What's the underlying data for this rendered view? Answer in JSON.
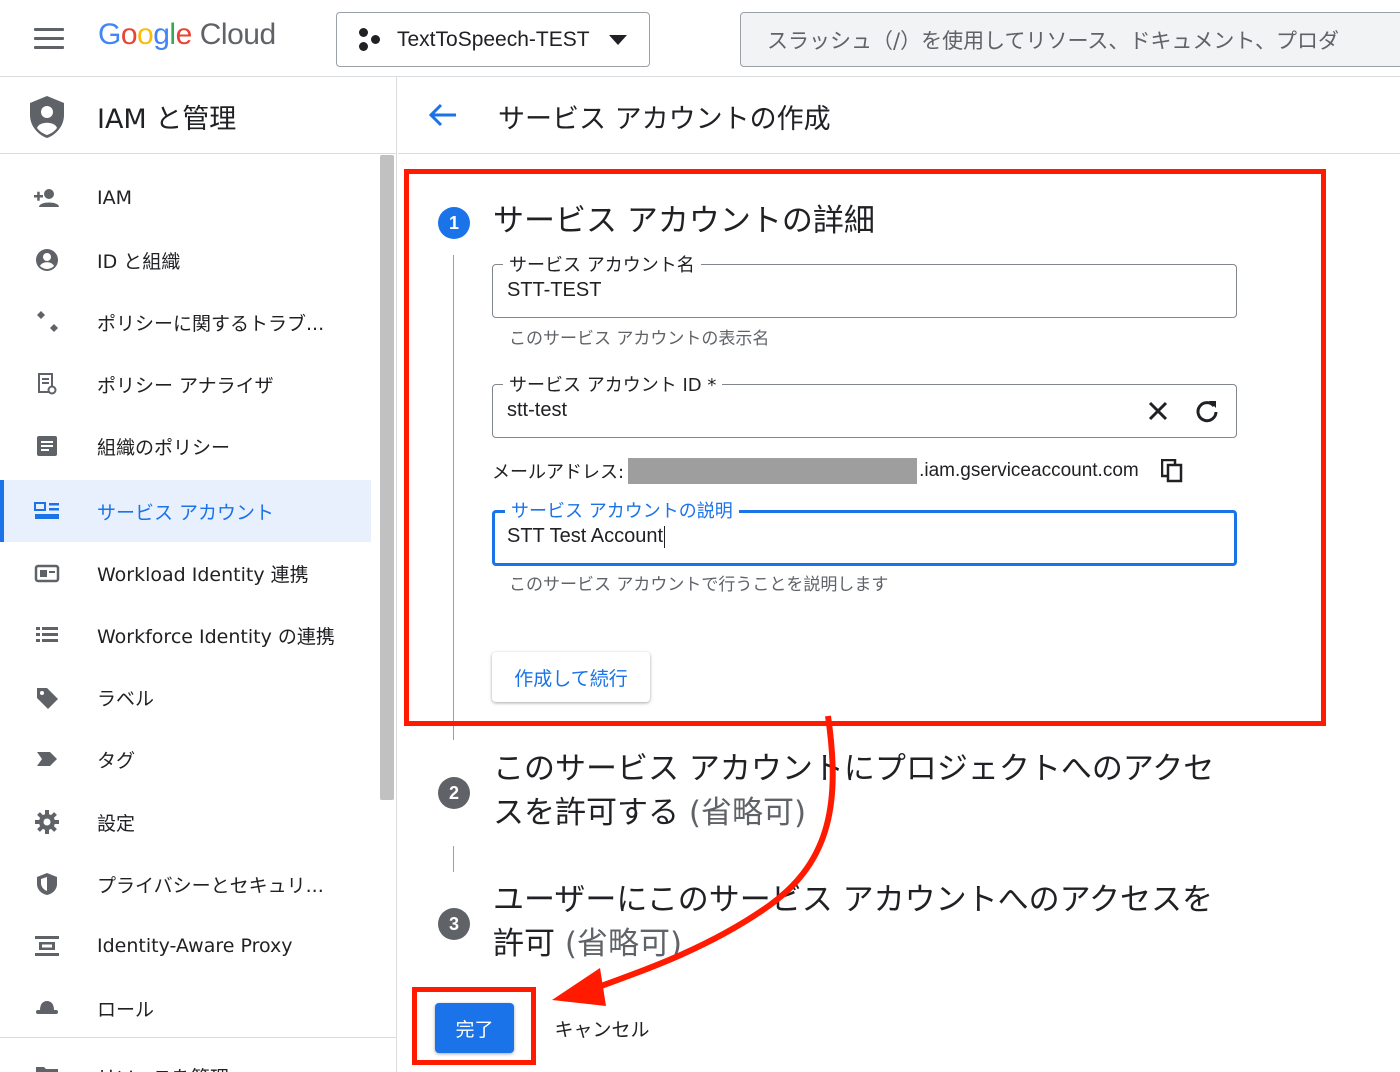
{
  "header": {
    "logo_text": "Google Cloud",
    "logo_letters": [
      "G",
      "o",
      "o",
      "g",
      "l",
      "e"
    ],
    "logo_cloud": "Cloud",
    "project_name": "TextToSpeech-TEST",
    "search_placeholder": "スラッシュ（/）を使用してリソース、ドキュメント、プロダ"
  },
  "sidebar": {
    "title": "IAM と管理",
    "items": [
      {
        "label": "IAM",
        "icon": "add-person-icon"
      },
      {
        "label": "ID と組織",
        "icon": "account-circle-icon"
      },
      {
        "label": "ポリシーに関するトラブ...",
        "icon": "wrench-icon"
      },
      {
        "label": "ポリシー アナライザ",
        "icon": "document-search-icon"
      },
      {
        "label": "組織のポリシー",
        "icon": "list-document-icon"
      },
      {
        "label": "サービス アカウント",
        "icon": "service-account-icon",
        "active": true
      },
      {
        "label": "Workload Identity 連携",
        "icon": "id-card-icon"
      },
      {
        "label": "Workforce Identity の連携",
        "icon": "list-icon"
      },
      {
        "label": "ラベル",
        "icon": "label-icon"
      },
      {
        "label": "タグ",
        "icon": "tag-arrow-icon"
      },
      {
        "label": "設定",
        "icon": "gear-icon"
      },
      {
        "label": "プライバシーとセキュリ...",
        "icon": "shield-icon"
      },
      {
        "label": "Identity-Aware Proxy",
        "icon": "proxy-icon"
      },
      {
        "label": "ロール",
        "icon": "hat-icon"
      },
      {
        "label": "リソースを管理",
        "icon": "folder-icon"
      }
    ]
  },
  "main": {
    "page_title": "サービス アカウントの作成",
    "step1": {
      "number": "1",
      "title": "サービス アカウントの詳細",
      "name_field": {
        "label": "サービス アカウント名",
        "value": "STT-TEST",
        "helper": "このサービス アカウントの表示名"
      },
      "id_field": {
        "label": "サービス アカウント ID *",
        "value": "stt-test"
      },
      "email_label": "メールアドレス:",
      "email_domain": ".iam.gserviceaccount.com",
      "desc_field": {
        "label": "サービス アカウントの説明",
        "value": "STT Test Account",
        "helper": "このサービス アカウントで行うことを説明します"
      },
      "create_button": "作成して続行"
    },
    "step2": {
      "number": "2",
      "title_line1": "このサービス アカウントにプロジェクトへのアクセ",
      "title_line2": "スを許可する",
      "optional": "(省略可)"
    },
    "step3": {
      "number": "3",
      "title_line1": "ユーザーにこのサービス アカウントへのアクセスを",
      "title_line2": "許可",
      "optional": "(省略可)"
    },
    "done_button": "完了",
    "cancel_button": "キャンセル"
  },
  "colors": {
    "accent": "#1a73e8",
    "annotation_red": "#ff1a00",
    "step_grey": "#5f6368"
  }
}
